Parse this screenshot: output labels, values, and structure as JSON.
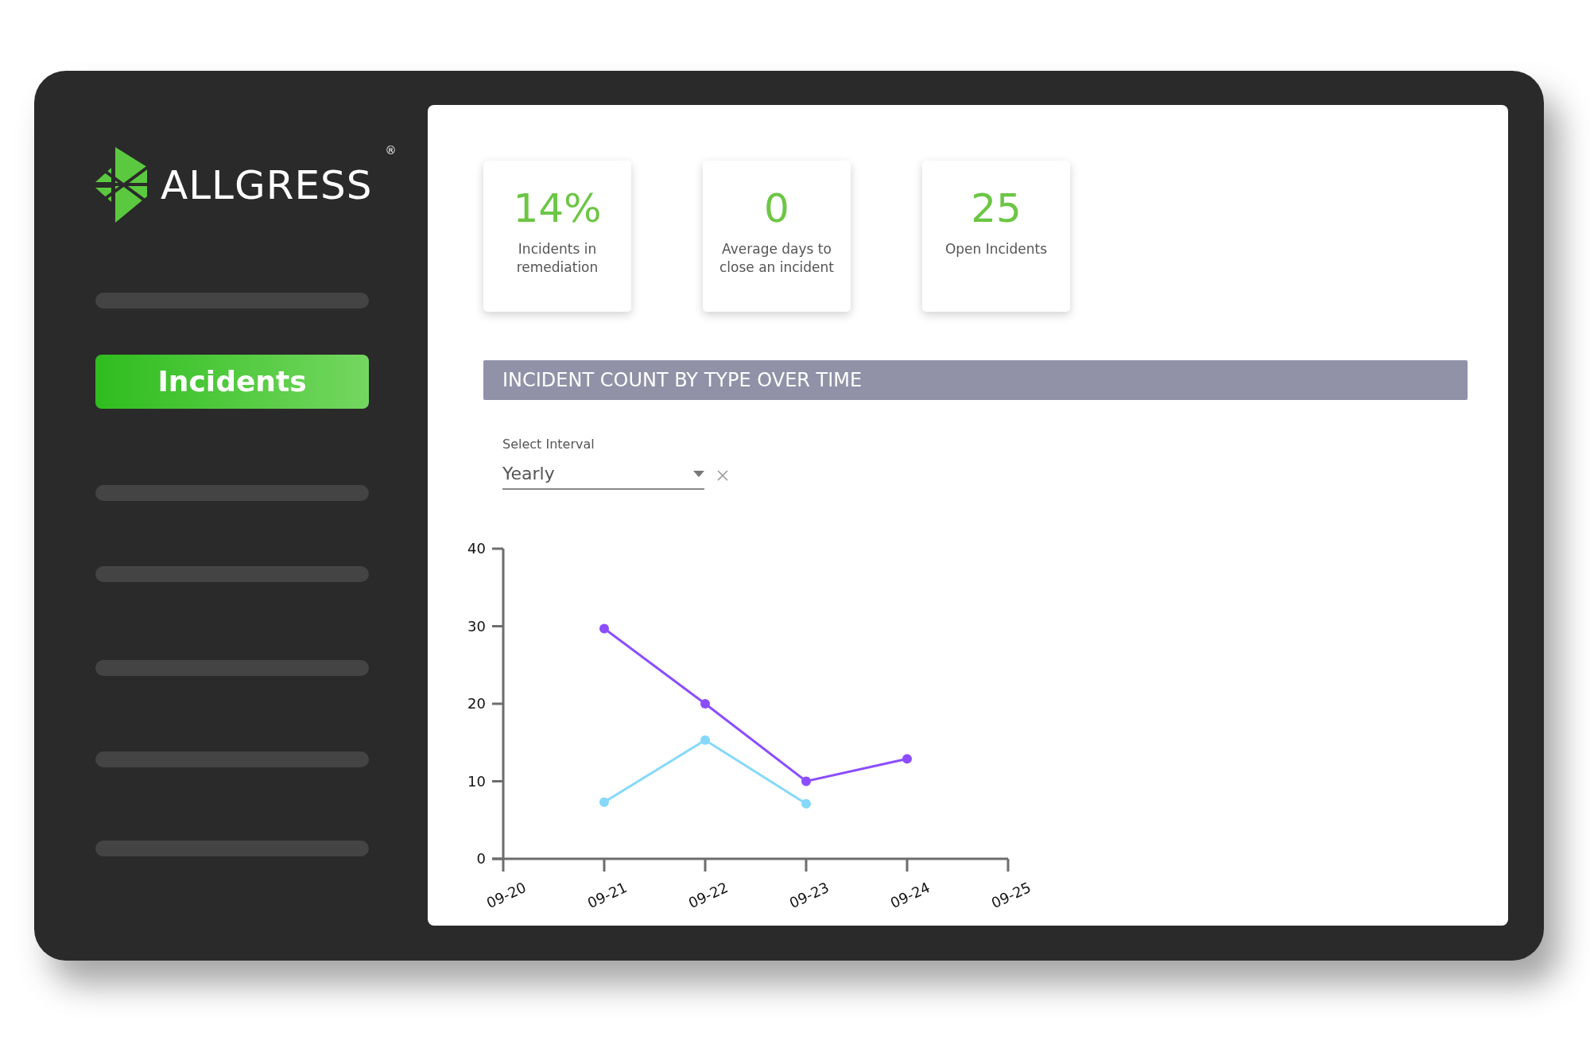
{
  "sidebar": {
    "logo": {
      "text": "ALLGRESS",
      "registered": "®"
    },
    "items": [
      {
        "kind": "placeholder"
      },
      {
        "kind": "link",
        "label": "Incidents",
        "selected": true
      },
      {
        "kind": "placeholder"
      },
      {
        "kind": "placeholder"
      },
      {
        "kind": "placeholder"
      },
      {
        "kind": "placeholder"
      },
      {
        "kind": "placeholder"
      }
    ]
  },
  "stats": [
    {
      "value": "14%",
      "label": "Incidents in remediation"
    },
    {
      "value": "0",
      "label": "Average days to close an incident"
    },
    {
      "value": "25",
      "label": "Open Incidents"
    }
  ],
  "section": {
    "title": "INCIDENT COUNT BY TYPE OVER TIME",
    "interval": {
      "label": "Select Interval",
      "value": "Yearly"
    },
    "chart": {
      "chart_data": {
        "type": "line",
        "categories": [
          "09-20",
          "09-21",
          "09-22",
          "09-23",
          "09-24",
          "09-25"
        ],
        "series": [
          {
            "color": "#8b4dff",
            "marker": "circle",
            "values": [
              null,
              29.7,
              20,
              10,
              12.9,
              null
            ]
          },
          {
            "color": "#85d8fb",
            "marker": "circle",
            "values": [
              null,
              7.3,
              15.3,
              7.1,
              null,
              null
            ]
          }
        ],
        "ylim": [
          0,
          40
        ],
        "yticks": [
          0,
          10,
          20,
          30,
          40
        ]
      }
    }
  }
}
